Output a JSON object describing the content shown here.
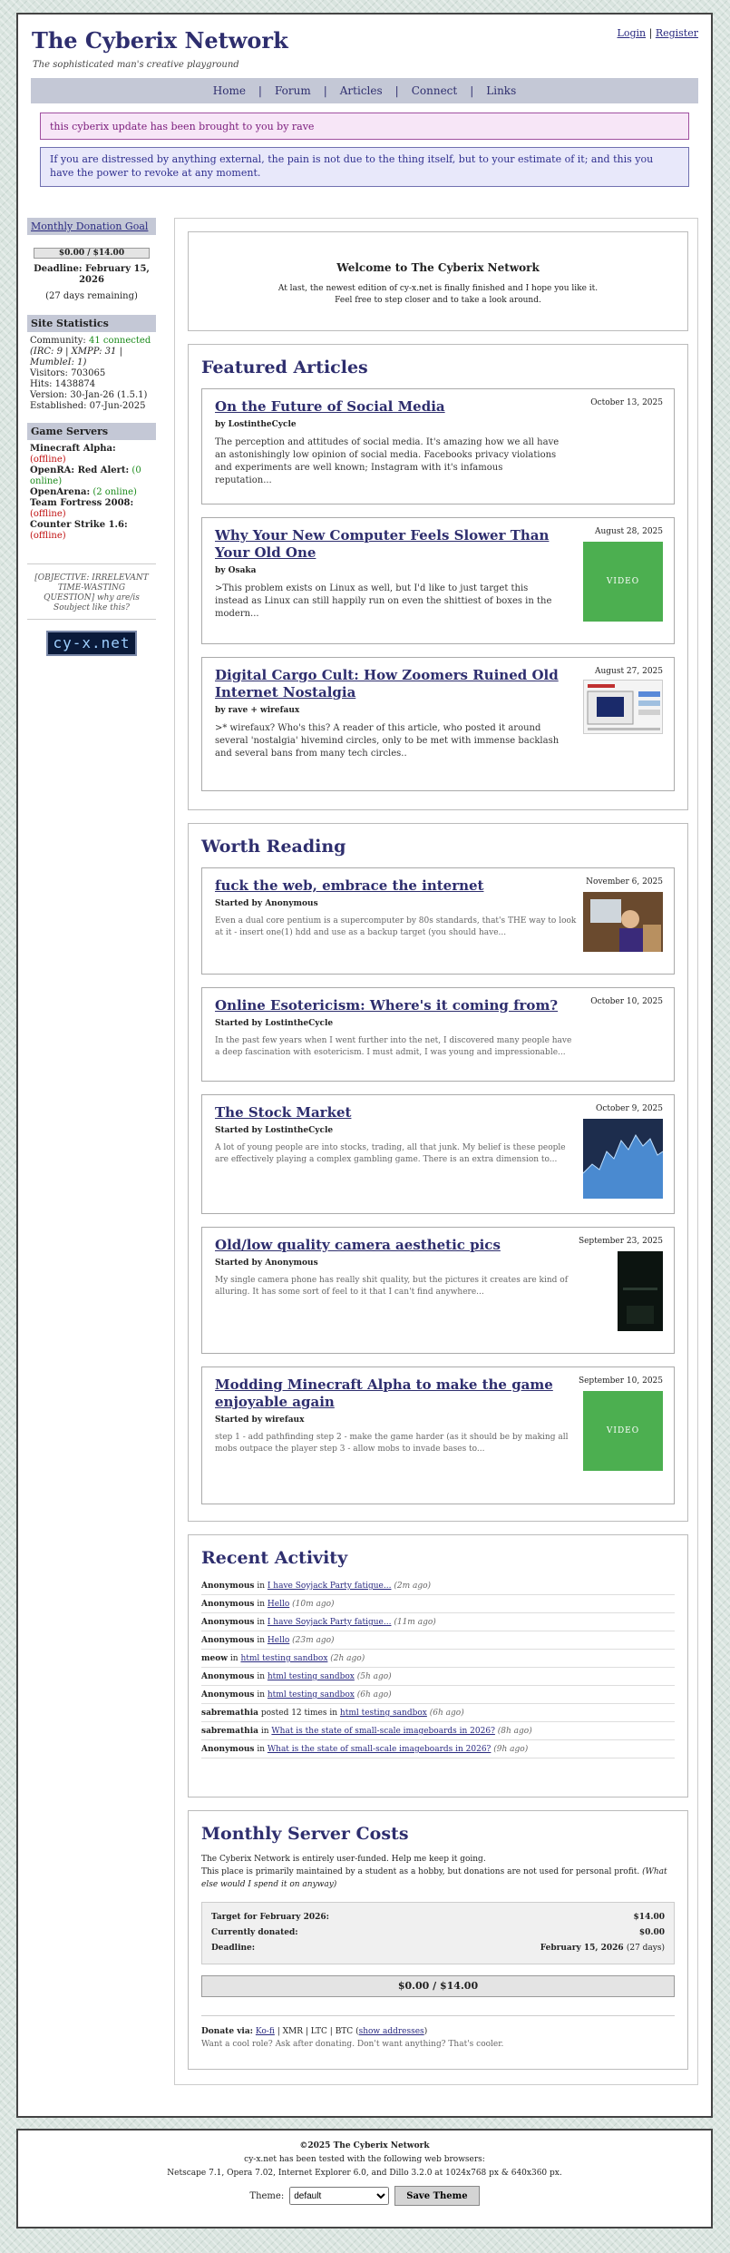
{
  "header": {
    "site_title": "The Cyberix Network",
    "tagline": "The sophisticated man's creative playground",
    "login": "Login",
    "auth_sep": "|",
    "register": "Register"
  },
  "nav": {
    "items": [
      "Home",
      "Forum",
      "Articles",
      "Connect",
      "Links"
    ],
    "sep": "|"
  },
  "update_banner": "this cyberix update has been brought to you by rave",
  "quote_banner": "If you are distressed by anything external, the pain is not due to the thing itself, but to your estimate of it; and this you have the power to revoke at any moment.",
  "sidebar": {
    "donation_goal": {
      "heading": "Monthly Donation Goal",
      "progress_text": "$0.00 / $14.00",
      "progress_fraction": 0.0,
      "deadline": "Deadline: February 15, 2026",
      "remaining": "(27 days remaining)"
    },
    "stats": {
      "heading": "Site Statistics",
      "community_label": "Community:",
      "community_value": "41 connected",
      "irc_line": "(IRC: 9 | XMPP: 31 | MumbleI: 1)",
      "visitors": "Visitors: 703065",
      "hits": "Hits: 1438874",
      "version": "Version: 30-Jan-26 (1.5.1)",
      "established": "Established: 07-Jun-2025"
    },
    "game_servers": {
      "heading": "Game Servers",
      "servers": [
        {
          "name": "Minecraft Alpha:",
          "status": "(offline)",
          "color": "#c01010"
        },
        {
          "name": "OpenRA: Red Alert:",
          "status": "(0 online)",
          "color": "#1a8a1a"
        },
        {
          "name": "OpenArena:",
          "status": "(2 online)",
          "color": "#1a8a1a"
        },
        {
          "name": "Team Fortress 2008:",
          "status": "(offline)",
          "color": "#c01010"
        },
        {
          "name": "Counter Strike 1.6:",
          "status": "(offline)",
          "color": "#c01010"
        }
      ]
    },
    "objective": "[OBJECTIVE: IRRELEVANT TIME-WASTING QUESTION] why are/is Soubject like this?",
    "badge": "cy-x.net"
  },
  "welcome": {
    "title": "Welcome to The Cyberix Network",
    "line1": "At last, the newest edition of cy-x.net is finally finished and I hope you like it.",
    "line2": "Feel free to step closer and to take a look around."
  },
  "featured": {
    "heading": "Featured Articles",
    "articles": [
      {
        "title": "On the Future of Social Media",
        "by": "by LostintheCycle",
        "date": "October 13, 2025",
        "excerpt": "The perception and attitudes of social media. It's amazing how we all have an astonishingly low opinion of social media. Facebooks privacy violations and experiments are well known; Instagram with it's infamous reputation...",
        "thumb": ""
      },
      {
        "title": "Why Your New Computer Feels Slower Than Your Old One",
        "by": "by Osaka",
        "date": "August 28, 2025",
        "excerpt": ">This problem exists on Linux as well, but I'd like to just target this instead as Linux can still happily run on even the shittiest of boxes in the modern...",
        "thumb": "VIDEO"
      },
      {
        "title": "Digital Cargo Cult: How Zoomers Ruined Old Internet Nostalgia",
        "by": "by rave + wirefaux",
        "date": "August 27, 2025",
        "excerpt": ">* wirefaux? Who's this? A reader of this article, who posted it around several 'nostalgia' hivemind circles, only to be met with immense backlash and several bans from many tech circles..",
        "thumb": ""
      }
    ]
  },
  "worth_reading": {
    "heading": "Worth Reading",
    "posts": [
      {
        "title": "fuck the web, embrace the internet",
        "by": "Started by Anonymous",
        "date": "November 6, 2025",
        "excerpt": "Even a dual core pentium is a supercomputer by 80s standards, that's THE way to look at it - insert one(1) hdd and use as a backup target (you should have...",
        "thumb": ""
      },
      {
        "title": "Online Esotericism: Where's it coming from?",
        "by": "Started by LostintheCycle",
        "date": "October 10, 2025",
        "excerpt": "In the past few years when I went further into the net, I discovered many people have a deep fascination with esotericism. I must admit, I was young and impressionable...",
        "thumb": ""
      },
      {
        "title": "The Stock Market",
        "by": "Started by LostintheCycle",
        "date": "October 9, 2025",
        "excerpt": "A lot of young people are into stocks, trading, all that junk. My belief is these people are effectively playing a complex gambling game. There is an extra dimension to...",
        "thumb": ""
      },
      {
        "title": "Old/low quality camera aesthetic pics",
        "by": "Started by Anonymous",
        "date": "September 23, 2025",
        "excerpt": "My single camera phone has really shit quality, but the pictures it creates are kind of alluring. It has some sort of feel to it that I can't find anywhere...",
        "thumb": ""
      },
      {
        "title": "Modding Minecraft Alpha to make the game enjoyable again",
        "by": "Started by wirefaux",
        "date": "September 10, 2025",
        "excerpt": "step 1 - add pathfinding step 2 - make the game harder (as it should be by making all mobs outpace the player step 3 - allow mobs to invade bases to...",
        "thumb": "VIDEO"
      }
    ]
  },
  "recent_activity": {
    "heading": "Recent Activity",
    "items": [
      {
        "who": "Anonymous",
        "verb": "in",
        "link": "I have Soyjack Party fatigue...",
        "ago": "(2m ago)"
      },
      {
        "who": "Anonymous",
        "verb": "in",
        "link": "Hello",
        "ago": "(10m ago)"
      },
      {
        "who": "Anonymous",
        "verb": "in",
        "link": "I have Soyjack Party fatigue...",
        "ago": "(11m ago)"
      },
      {
        "who": "Anonymous",
        "verb": "in",
        "link": "Hello",
        "ago": "(23m ago)"
      },
      {
        "who": "meow",
        "verb": "in",
        "link": "html testing sandbox",
        "ago": "(2h ago)"
      },
      {
        "who": "Anonymous",
        "verb": "in",
        "link": "html testing sandbox",
        "ago": "(5h ago)"
      },
      {
        "who": "Anonymous",
        "verb": "in",
        "link": "html testing sandbox",
        "ago": "(6h ago)"
      },
      {
        "who": "sabremathia",
        "verb": "posted 12 times in",
        "link": "html testing sandbox",
        "ago": "(6h ago)"
      },
      {
        "who": "sabremathia",
        "verb": "in",
        "link": "What is the state of small-scale imageboards in 2026?",
        "ago": "(8h ago)"
      },
      {
        "who": "Anonymous",
        "verb": "in",
        "link": "What is the state of small-scale imageboards in 2026?",
        "ago": "(9h ago)"
      }
    ]
  },
  "server_costs": {
    "heading": "Monthly Server Costs",
    "p1": "The Cyberix Network is entirely user-funded. Help me keep it going.",
    "p2": "This place is primarily maintained by a student as a hobby, but donations are not used for personal profit.",
    "p2_italic": "(What else would I spend it on anyway)",
    "target_label": "Target for February 2026:",
    "target_value": "$14.00",
    "donated_label": "Currently donated:",
    "donated_value": "$0.00",
    "deadline_label": "Deadline:",
    "deadline_value": "February 15, 2026",
    "deadline_extra": "(27 days)",
    "progress_text": "$0.00 / $14.00",
    "progress_fraction": 0.0,
    "donate_label": "Donate via:",
    "donate_methods": [
      "Ko-fi",
      "XMR",
      "LTC",
      "BTC"
    ],
    "show_addresses": "show addresses",
    "note": "Want a cool role? Ask after donating. Don't want anything? That's cooler."
  },
  "footer": {
    "copyright": "©2025 The Cyberix Network",
    "tested_line": "cy-x.net has been tested with the following web browsers:",
    "browsers_line": "Netscape 7.1, Opera 7.02, Internet Explorer 6.0, and Dillo 3.2.0 at 1024x768 px & 640x360 px.",
    "theme_label": "Theme:",
    "theme_selected": "default",
    "save_button": "Save Theme"
  }
}
